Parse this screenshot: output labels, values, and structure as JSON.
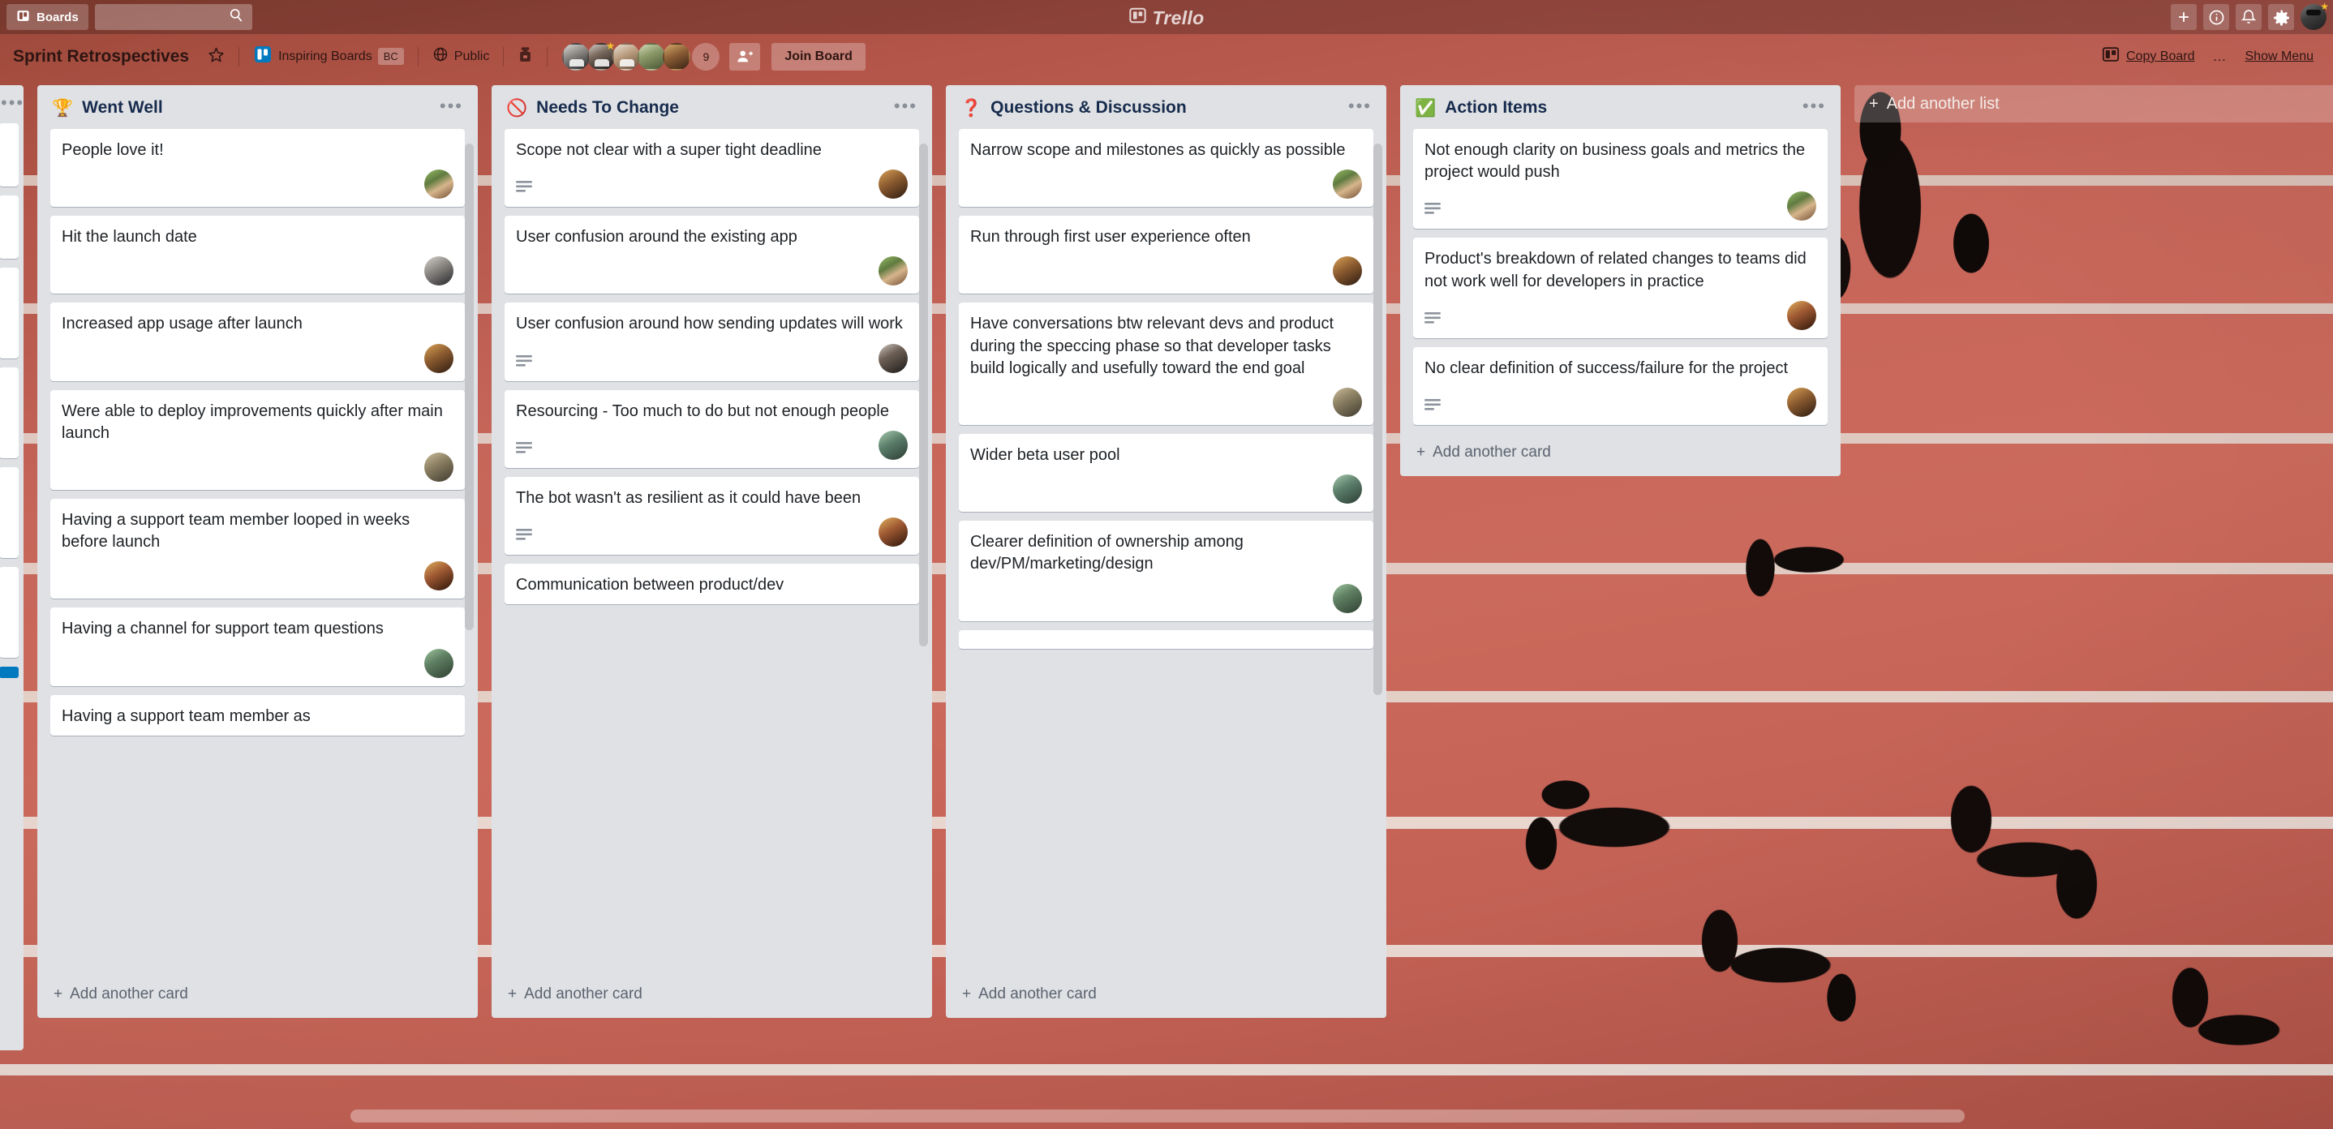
{
  "topbar": {
    "boards_button": "Boards",
    "boards_icon": "trello-board-icon",
    "search_placeholder": "",
    "search_value": "",
    "search_icon": "search-icon",
    "logo_text": "Trello",
    "logo_icon": "trello-logo-icon",
    "add_icon": "plus-icon",
    "info_icon": "info-circle-icon",
    "notifications_icon": "bell-icon",
    "settings_icon": "gear-icon",
    "avatar_icon": "user-avatar",
    "avatar_badge": "★"
  },
  "board_header": {
    "title": "Sprint Retrospectives",
    "star_icon": "star-outline-icon",
    "team_icon": "trello-team-icon",
    "team_name": "Inspiring Boards",
    "team_badge": "BC",
    "visibility_icon": "globe-icon",
    "visibility": "Public",
    "butler_icon": "butler-robot-icon",
    "member_overflow_count": "9",
    "add_member_icon": "add-person-icon",
    "join_board_label": "Join Board",
    "copy_board_icon": "board-icon",
    "copy_board_label": "Copy Board",
    "more_dots": "…",
    "show_menu_label": "Show Menu"
  },
  "board": {
    "add_list_label": "Add another list",
    "add_card_label": "Add another card",
    "list_menu_dots": "•••",
    "lists": [
      {
        "emoji": "🏆",
        "title": "Went Well",
        "cards": [
          {
            "text": "People love it!",
            "has_description": false,
            "avatar": "av-a"
          },
          {
            "text": "Hit the launch date",
            "has_description": false,
            "avatar": "av-b"
          },
          {
            "text": "Increased app usage after launch",
            "has_description": false,
            "avatar": "av-c"
          },
          {
            "text": "Were able to deploy improvements quickly after main launch",
            "has_description": false,
            "avatar": "av-d"
          },
          {
            "text": "Having a support team member looped in weeks before launch",
            "has_description": false,
            "avatar": "av-e"
          },
          {
            "text": "Having a channel for support team questions",
            "has_description": false,
            "avatar": "av-f"
          },
          {
            "text": "Having a support team member as",
            "has_description": false,
            "avatar": ""
          }
        ]
      },
      {
        "emoji": "🚫",
        "title": "Needs To Change",
        "cards": [
          {
            "text": "Scope not clear with a super tight deadline",
            "has_description": true,
            "avatar": "av-c"
          },
          {
            "text": "User confusion around the existing app",
            "has_description": false,
            "avatar": "av-a"
          },
          {
            "text": "User confusion around how sending updates will work",
            "has_description": true,
            "avatar": "av-h"
          },
          {
            "text": "Resourcing - Too much to do but not enough people",
            "has_description": true,
            "avatar": "av-g"
          },
          {
            "text": "The bot wasn't as resilient as it could have been",
            "has_description": true,
            "avatar": "av-e"
          },
          {
            "text": "Communication between product/dev",
            "has_description": false,
            "avatar": ""
          }
        ]
      },
      {
        "emoji": "❓",
        "title": "Questions & Discussion",
        "cards": [
          {
            "text": "Narrow scope and milestones as quickly as possible",
            "has_description": false,
            "avatar": "av-a"
          },
          {
            "text": "Run through first user experience often",
            "has_description": false,
            "avatar": "av-c"
          },
          {
            "text": "Have conversations btw relevant devs and product during the speccing phase so that developer tasks build logically and usefully toward the end goal",
            "has_description": false,
            "avatar": "av-d"
          },
          {
            "text": "Wider beta user pool",
            "has_description": false,
            "avatar": "av-g"
          },
          {
            "text": "Clearer definition of ownership among dev/PM/marketing/design",
            "has_description": false,
            "avatar": "av-f"
          }
        ]
      },
      {
        "emoji": "✅",
        "title": "Action Items",
        "cards": [
          {
            "text": "Not enough clarity on business goals and metrics the project would push",
            "has_description": true,
            "avatar": "av-a"
          },
          {
            "text": "Product's breakdown of related changes to teams did not work well for developers in practice",
            "has_description": true,
            "avatar": "av-e"
          },
          {
            "text": "No clear definition of success/failure for the project",
            "has_description": true,
            "avatar": "av-c"
          }
        ]
      }
    ]
  },
  "colors": {
    "board_background": "#c4655a",
    "list_background": "#dfe1e4",
    "card_background": "#ffffff",
    "text_primary": "#172b4d",
    "trello_blue": "#0079bf",
    "header_text": "#2e1512"
  }
}
